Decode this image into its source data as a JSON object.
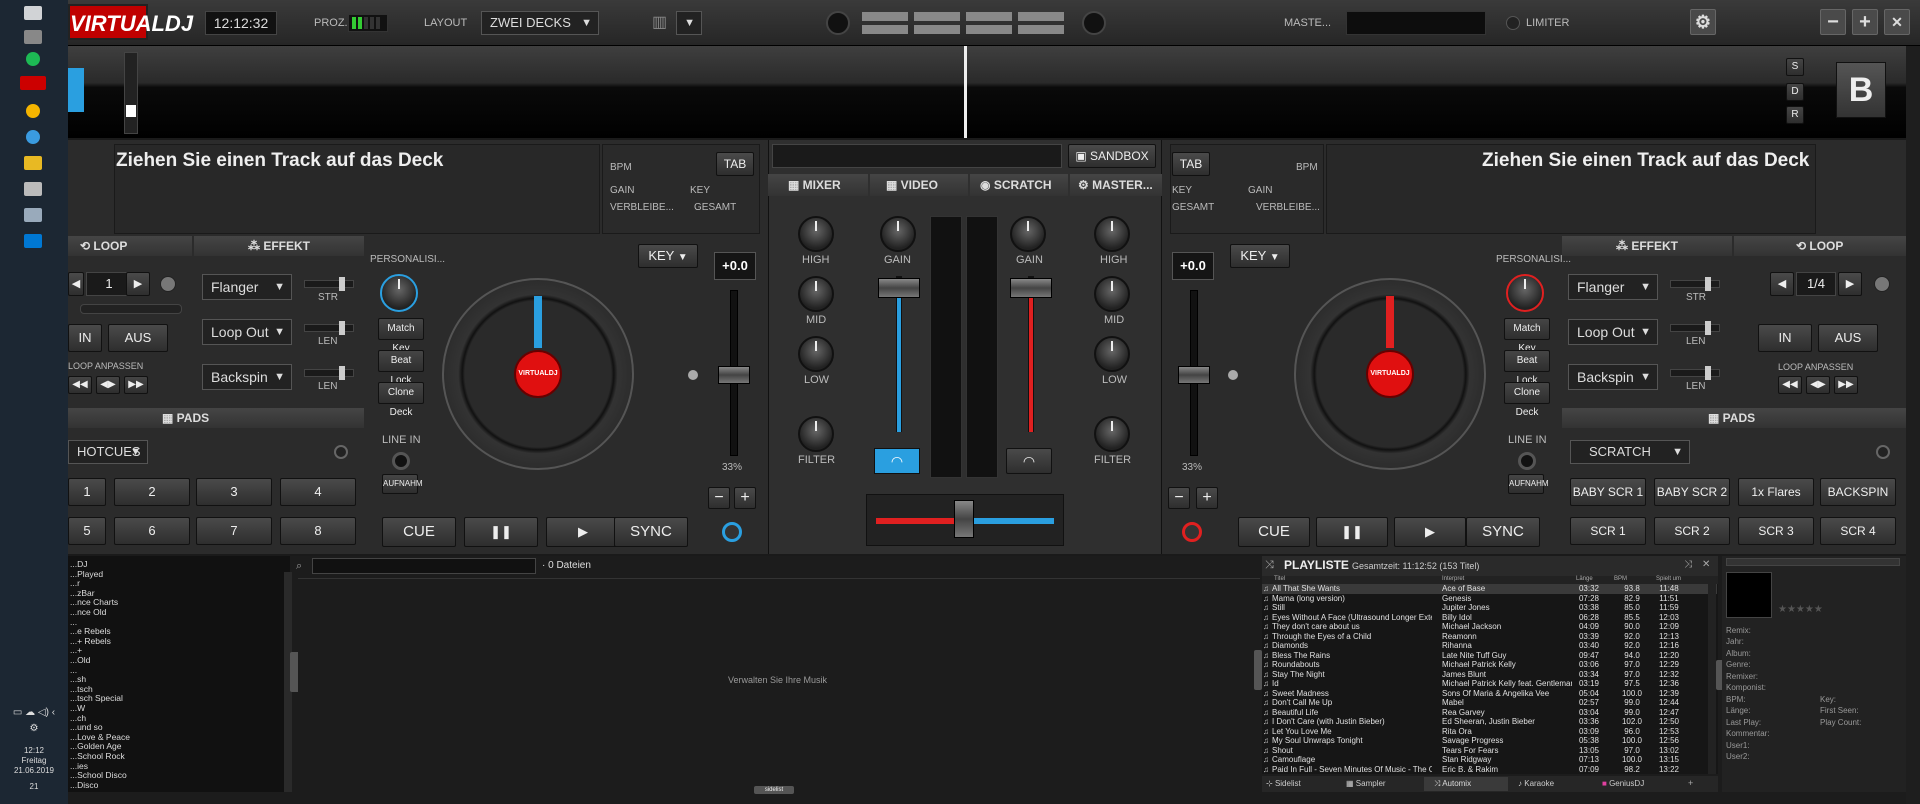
{
  "app": {
    "logo": "VIRTUALDJ",
    "clock": "12:12:32",
    "proc_label": "PROZ...",
    "layout_label": "LAYOUT",
    "layout_value": "ZWEI DECKS",
    "master_label": "MASTE...",
    "limiter_label": "LIMITER"
  },
  "window": {
    "minimize": "−",
    "maximize": "+",
    "close": "✕"
  },
  "taskbar": {
    "time": "12:12",
    "day": "Freitag",
    "date": "21.06.2019",
    "badge": "21"
  },
  "deck_a": {
    "track_title": "Ziehen Sie einen Track auf das Deck",
    "bpm_label": "BPM",
    "tab_label": "TAB",
    "gain_label": "GAIN",
    "key_label": "KEY",
    "remaining_label": "VERBLEIBE...",
    "total_label": "GESAMT",
    "loop_label": "LOOP",
    "effect_label": "EFFEKT",
    "loop_value": "1",
    "in_label": "IN",
    "out_label": "AUS",
    "loop_adjust_label": "LOOP ANPASSEN",
    "fx1": "Flanger",
    "fx2": "Loop Out",
    "fx3": "Backspin",
    "str_label": "STR",
    "len1_label": "LEN",
    "len2_label": "LEN",
    "personalize_label": "PERSONALISI...",
    "match_key": "Match Key",
    "beat_lock": "Beat Lock",
    "clone_deck": "Clone Deck",
    "line_in_label": "LINE IN",
    "record_label": "AUFNAHM",
    "key_button": "KEY",
    "pitch_value": "+0.0",
    "pitch_percent": "33%",
    "pads_label": "PADS",
    "pads_mode": "HOTCUES",
    "pads": [
      "1",
      "2",
      "3",
      "4",
      "5",
      "6",
      "7",
      "8"
    ],
    "cue": "CUE",
    "pause": "❚❚",
    "play": "▶",
    "sync": "SYNC",
    "vinyl_label": "VIRTUALDJ"
  },
  "deck_b": {
    "track_title": "Ziehen Sie einen Track auf das Deck",
    "bpm_label": "BPM",
    "tab_label": "TAB",
    "gain_label": "GAIN",
    "key_label": "KEY",
    "remaining_label": "VERBLEIBE...",
    "total_label": "GESAMT",
    "loop_label": "LOOP",
    "effect_label": "EFFEKT",
    "loop_value": "1/4",
    "in_label": "IN",
    "out_label": "AUS",
    "loop_adjust_label": "LOOP ANPASSEN",
    "fx1": "Flanger",
    "fx2": "Loop Out",
    "fx3": "Backspin",
    "str_label": "STR",
    "len1_label": "LEN",
    "len2_label": "LEN",
    "personalize_label": "PERSONALISI...",
    "match_key": "Match Key",
    "beat_lock": "Beat Lock",
    "clone_deck": "Clone Deck",
    "line_in_label": "LINE IN",
    "record_label": "AUFNAHM",
    "key_button": "KEY",
    "pitch_value": "+0.0",
    "pitch_percent": "33%",
    "pads_label": "PADS",
    "pads_mode": "SCRATCH",
    "pads": [
      "BABY SCR 1",
      "BABY SCR 2",
      "1x Flares",
      "BACKSPIN",
      "SCR 1",
      "SCR 2",
      "SCR 3",
      "SCR 4"
    ],
    "cue": "CUE",
    "pause": "❚❚",
    "play": "▶",
    "sync": "SYNC",
    "vinyl_label": "VIRTUALDJ",
    "deck_letter": "B",
    "side_buttons": [
      "S",
      "D",
      "R"
    ]
  },
  "mixer": {
    "sandbox": "SANDBOX",
    "tabs": [
      "MIXER",
      "VIDEO",
      "SCRATCH",
      "MASTER..."
    ],
    "high": "HIGH",
    "mid": "MID",
    "low": "LOW",
    "filter": "FILTER",
    "gain": "GAIN"
  },
  "browser": {
    "search_placeholder": "",
    "file_count": "0 Dateien",
    "empty_hint": "Verwalten Sie Ihre Musik",
    "sidelist_tab": "sidelist",
    "side_tab": "Sidelist",
    "tree": [
      "...DJ",
      "...Played",
      "...r",
      "...zBar",
      "...nce Charts",
      "...nce Old",
      "...",
      "...e Rebels",
      "...+ Rebels",
      "...+",
      "...Old",
      "...",
      "...sh",
      "...tsch",
      "...tsch Special",
      "...W",
      "...ch",
      "...und so",
      "...Love & Peace",
      "...Golden Age",
      "...School Rock",
      "...ies",
      "...School Disco",
      "...Disco"
    ]
  },
  "playlist": {
    "title": "PLAYLISTE",
    "summary": "Gesamtzeit: 11:12:52 (153 Titel)",
    "columns": [
      "Titel",
      "Interpret",
      "Länge",
      "BPM",
      "Spielt um"
    ],
    "rows": [
      [
        "All That She Wants",
        "Ace of Base",
        "03:32",
        "93.8",
        "11:48"
      ],
      [
        "Mama (long version)",
        "Genesis",
        "07:28",
        "82.9",
        "11:51"
      ],
      [
        "Still",
        "Jupiter Jones",
        "03:38",
        "85.0",
        "11:59"
      ],
      [
        "Eyes Without A Face (Ultrasound Longer Extended Version)",
        "Billy Idol",
        "06:28",
        "85.5",
        "12:03"
      ],
      [
        "They don't care about us",
        "Michael Jackson",
        "04:09",
        "90.0",
        "12:09"
      ],
      [
        "Through the Eyes of a Child",
        "Reamonn",
        "03:39",
        "92.0",
        "12:13"
      ],
      [
        "Diamonds",
        "Rihanna",
        "03:40",
        "92.0",
        "12:16"
      ],
      [
        "Bless The Rains",
        "Late Nite Tuff Guy",
        "09:47",
        "94.0",
        "12:20"
      ],
      [
        "Roundabouts",
        "Michael Patrick Kelly",
        "03:06",
        "97.0",
        "12:29"
      ],
      [
        "Stay The Night",
        "James Blunt",
        "03:34",
        "97.0",
        "12:32"
      ],
      [
        "Id",
        "Michael Patrick Kelly feat. Gentleman",
        "03:19",
        "97.5",
        "12:36"
      ],
      [
        "Sweet Madness",
        "Sons Of Maria & Angelika Vee",
        "05:04",
        "100.0",
        "12:39"
      ],
      [
        "Don't Call Me Up",
        "Mabel",
        "02:57",
        "99.0",
        "12:44"
      ],
      [
        "Beautiful Life",
        "Rea Garvey",
        "03:04",
        "99.0",
        "12:47"
      ],
      [
        "I Don't Care (with Justin Bieber)",
        "Ed Sheeran, Justin Bieber",
        "03:36",
        "102.0",
        "12:50"
      ],
      [
        "Let You Love Me",
        "Rita Ora",
        "03:09",
        "96.0",
        "12:53"
      ],
      [
        "My Soul Unwraps Tonight",
        "Savage Progress",
        "05:38",
        "100.0",
        "12:56"
      ],
      [
        "Shout",
        "Tears For Fears",
        "13:05",
        "97.0",
        "13:02"
      ],
      [
        "Camouflage",
        "Stan Ridgway",
        "07:13",
        "100.0",
        "13:15"
      ],
      [
        "Paid In Full - Seven Minutes Of Music - The Coldcut Remix",
        "Eric B. & Rakim",
        "07:09",
        "98.2",
        "13:22"
      ]
    ]
  },
  "bottom_tabs": [
    "Sidelist",
    "Sampler",
    "Automix",
    "Karaoke",
    "GeniusDJ"
  ],
  "info": {
    "labels": [
      "Remix:",
      "Jahr:",
      "Album:",
      "Genre:",
      "Remixer:",
      "Komponist:",
      "BPM:",
      "Länge:",
      "Last Play:",
      "Kommentar:",
      "User1:",
      "User2:"
    ],
    "right_labels": [
      "Key:",
      "First Seen:",
      "Play Count:"
    ],
    "stars": "★★★★★"
  },
  "colors": {
    "deck_a": "#2a9fe0",
    "deck_b": "#e02020",
    "accent": "#c00000"
  }
}
